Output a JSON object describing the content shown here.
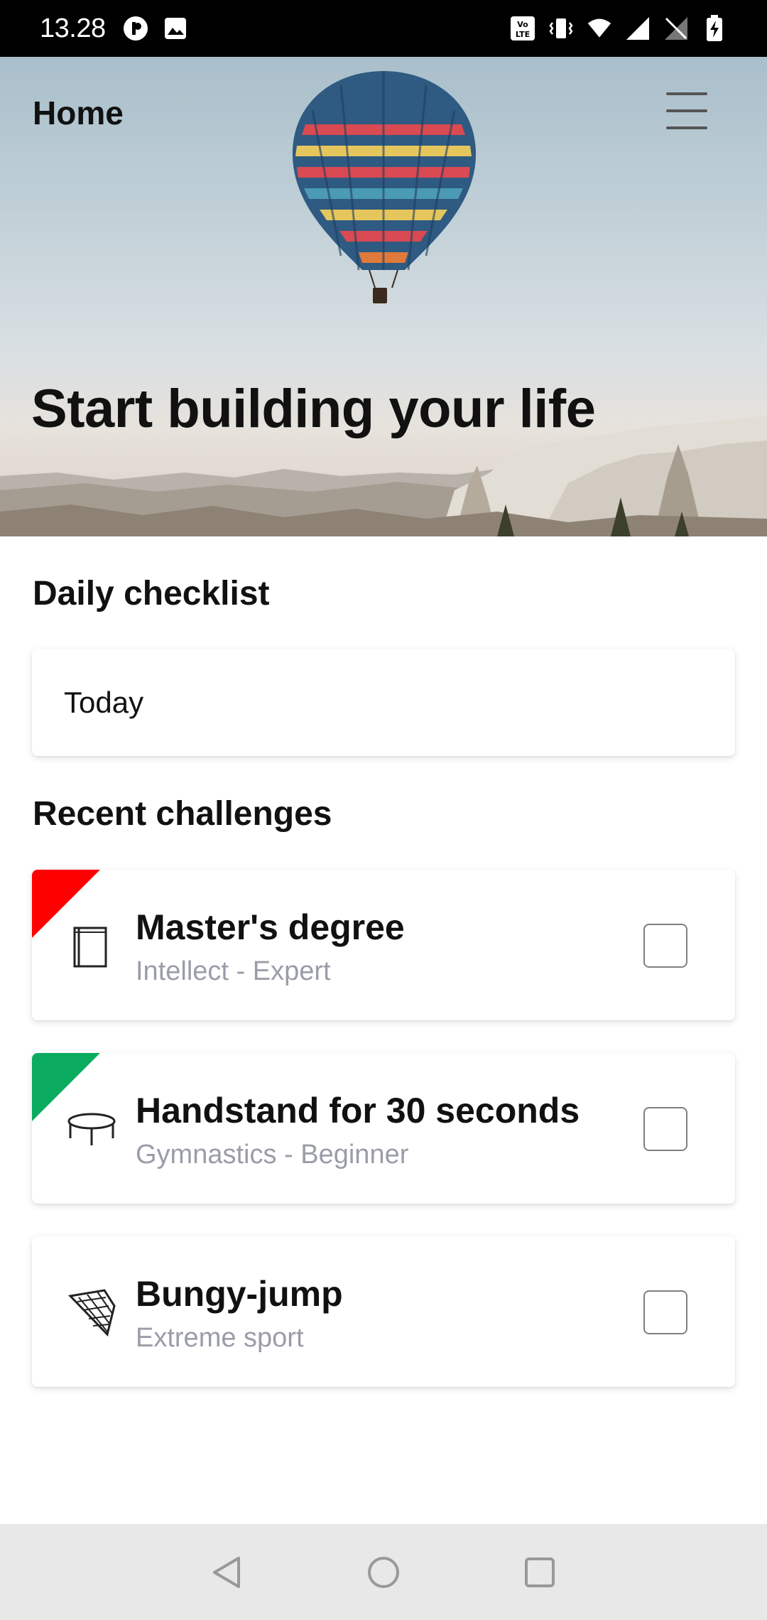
{
  "status_bar": {
    "time": "13.28",
    "left_icons": [
      "circle-p-icon",
      "image-icon"
    ],
    "right_icons": [
      "volte-icon",
      "vibrate-icon",
      "wifi-icon",
      "signal-icon",
      "no-signal-icon",
      "battery-charging-icon"
    ]
  },
  "header": {
    "title": "Home",
    "menu_icon": "hamburger-menu-icon"
  },
  "hero": {
    "headline": "Start building your life"
  },
  "daily_checklist": {
    "heading": "Daily checklist",
    "today_label": "Today"
  },
  "recent_challenges": {
    "heading": "Recent challenges",
    "items": [
      {
        "title": "Master's degree",
        "subtitle": "Intellect - Expert",
        "icon": "book-icon",
        "corner_color": "#ff0000",
        "checked": false
      },
      {
        "title": "Handstand for 30 seconds",
        "subtitle": "Gymnastics - Beginner",
        "icon": "trampoline-icon",
        "corner_color": "#0aab5f",
        "checked": false
      },
      {
        "title": "Bungy-jump",
        "subtitle": "Extreme sport",
        "icon": "net-icon",
        "corner_color": "",
        "checked": false
      }
    ]
  },
  "nav_bar": {
    "buttons": [
      "back-icon",
      "home-icon",
      "recents-icon"
    ]
  },
  "colors": {
    "text_primary": "#111111",
    "text_secondary": "#9a9da8",
    "expert_corner": "#ff0000",
    "beginner_corner": "#0aab5f"
  }
}
